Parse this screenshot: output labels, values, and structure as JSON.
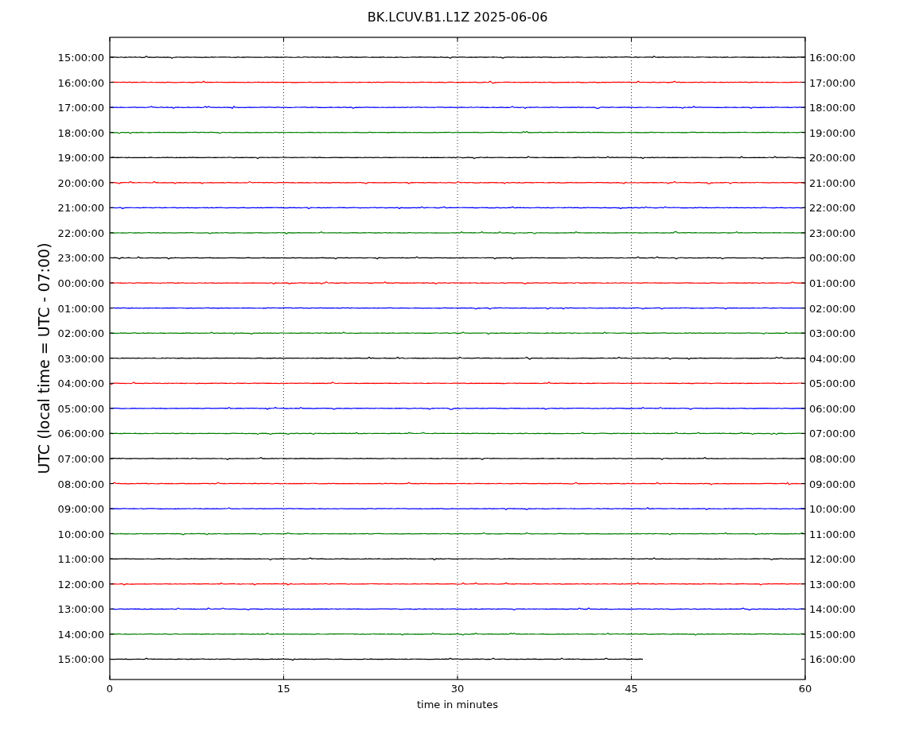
{
  "title": "BK.LCUV.B1.L1Z 2025-06-06",
  "ylabel": "UTC (local time = UTC - 07:00)",
  "xlabel": "time in minutes",
  "xticks": [
    "0",
    "15",
    "30",
    "45",
    "60"
  ],
  "traces": [
    {
      "left": "15:00:00",
      "right": "16:00:00",
      "color": "#000000",
      "complete": true
    },
    {
      "left": "16:00:00",
      "right": "17:00:00",
      "color": "#ff0000",
      "complete": true
    },
    {
      "left": "17:00:00",
      "right": "18:00:00",
      "color": "#0000ff",
      "complete": true
    },
    {
      "left": "18:00:00",
      "right": "19:00:00",
      "color": "#008000",
      "complete": true
    },
    {
      "left": "19:00:00",
      "right": "20:00:00",
      "color": "#000000",
      "complete": true
    },
    {
      "left": "20:00:00",
      "right": "21:00:00",
      "color": "#ff0000",
      "complete": true
    },
    {
      "left": "21:00:00",
      "right": "22:00:00",
      "color": "#0000ff",
      "complete": true
    },
    {
      "left": "22:00:00",
      "right": "23:00:00",
      "color": "#008000",
      "complete": true
    },
    {
      "left": "23:00:00",
      "right": "00:00:00",
      "color": "#000000",
      "complete": true
    },
    {
      "left": "00:00:00",
      "right": "01:00:00",
      "color": "#ff0000",
      "complete": true
    },
    {
      "left": "01:00:00",
      "right": "02:00:00",
      "color": "#0000ff",
      "complete": true
    },
    {
      "left": "02:00:00",
      "right": "03:00:00",
      "color": "#008000",
      "complete": true
    },
    {
      "left": "03:00:00",
      "right": "04:00:00",
      "color": "#000000",
      "complete": true
    },
    {
      "left": "04:00:00",
      "right": "05:00:00",
      "color": "#ff0000",
      "complete": true
    },
    {
      "left": "05:00:00",
      "right": "06:00:00",
      "color": "#0000ff",
      "complete": true
    },
    {
      "left": "06:00:00",
      "right": "07:00:00",
      "color": "#008000",
      "complete": true
    },
    {
      "left": "07:00:00",
      "right": "08:00:00",
      "color": "#000000",
      "complete": true
    },
    {
      "left": "08:00:00",
      "right": "09:00:00",
      "color": "#ff0000",
      "complete": true
    },
    {
      "left": "09:00:00",
      "right": "10:00:00",
      "color": "#0000ff",
      "complete": true
    },
    {
      "left": "10:00:00",
      "right": "11:00:00",
      "color": "#008000",
      "complete": true
    },
    {
      "left": "11:00:00",
      "right": "12:00:00",
      "color": "#000000",
      "complete": true
    },
    {
      "left": "12:00:00",
      "right": "13:00:00",
      "color": "#ff0000",
      "complete": true
    },
    {
      "left": "13:00:00",
      "right": "14:00:00",
      "color": "#0000ff",
      "complete": true
    },
    {
      "left": "14:00:00",
      "right": "15:00:00",
      "color": "#008000",
      "complete": true
    },
    {
      "left": "15:00:00",
      "right": "16:00:00",
      "color": "#000000",
      "complete": false
    }
  ]
}
